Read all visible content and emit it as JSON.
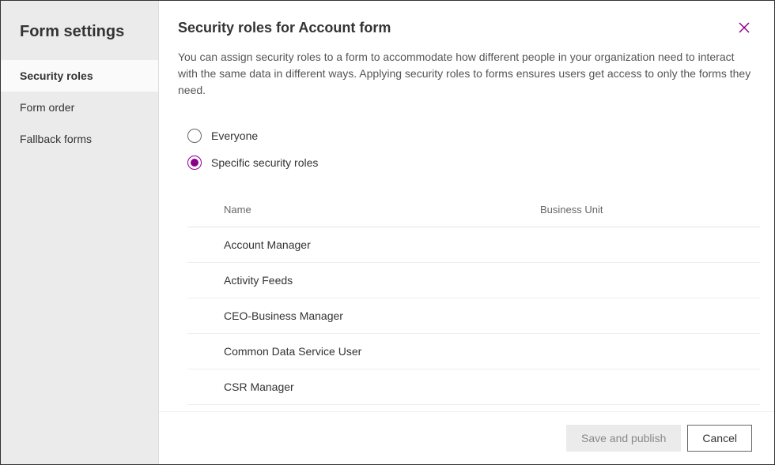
{
  "sidebar": {
    "title": "Form settings",
    "items": [
      {
        "label": "Security roles",
        "active": true
      },
      {
        "label": "Form order",
        "active": false
      },
      {
        "label": "Fallback forms",
        "active": false
      }
    ]
  },
  "main": {
    "title": "Security roles for Account form",
    "description": "You can assign security roles to a form to accommodate how different people in your organization need to interact with the same data in different ways. Applying security roles to forms ensures users get access to only the forms they need.",
    "radio": {
      "options": [
        {
          "label": "Everyone",
          "selected": false
        },
        {
          "label": "Specific security roles",
          "selected": true
        }
      ]
    },
    "table": {
      "columns": {
        "name": "Name",
        "business_unit": "Business Unit"
      },
      "rows": [
        {
          "name": "Account Manager",
          "business_unit": ""
        },
        {
          "name": "Activity Feeds",
          "business_unit": ""
        },
        {
          "name": "CEO-Business Manager",
          "business_unit": ""
        },
        {
          "name": "Common Data Service User",
          "business_unit": ""
        },
        {
          "name": "CSR Manager",
          "business_unit": ""
        }
      ]
    }
  },
  "footer": {
    "save_label": "Save and publish",
    "cancel_label": "Cancel"
  }
}
